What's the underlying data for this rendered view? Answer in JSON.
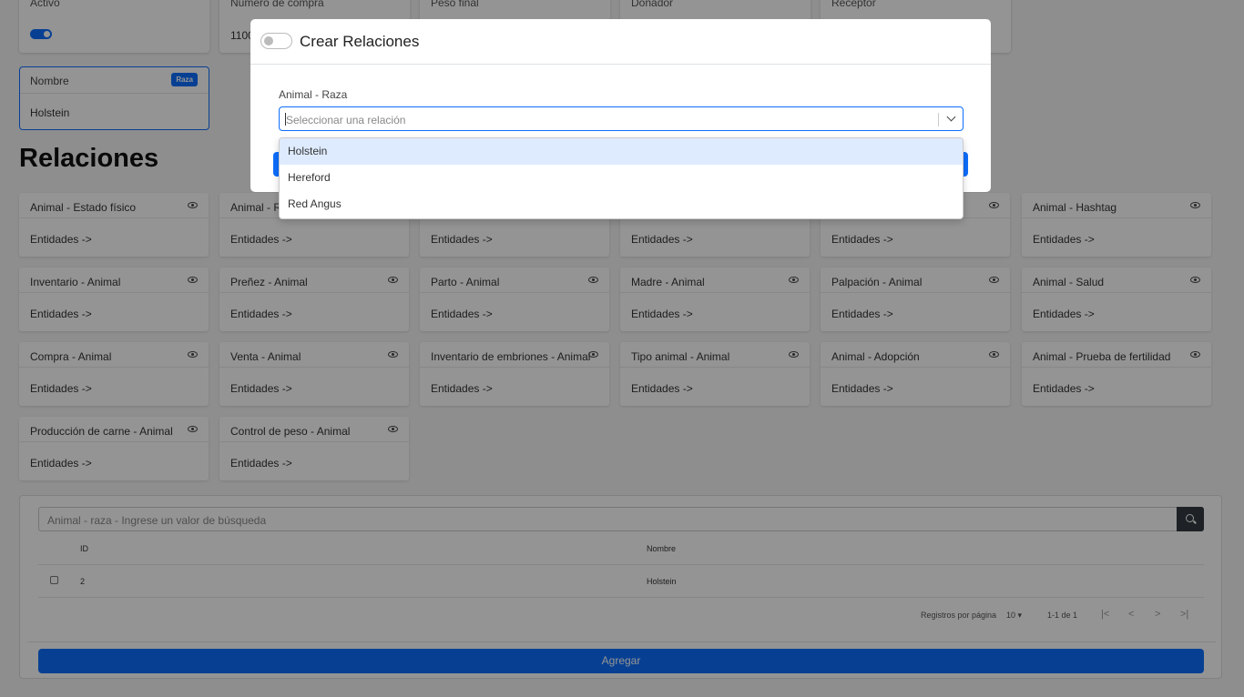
{
  "top_cards": [
    {
      "label": "Activo",
      "value": ""
    },
    {
      "label": "Número de compra",
      "value": "1100"
    },
    {
      "label": "Peso final",
      "value": ""
    },
    {
      "label": "Donador",
      "value": ""
    },
    {
      "label": "Receptor",
      "value": ""
    }
  ],
  "name_card": {
    "label": "Nombre",
    "badge": "Raza",
    "value": "Holstein"
  },
  "section_title": "Relaciones",
  "relations": [
    {
      "title": "Animal - Estado físico",
      "body": "Entidades ->"
    },
    {
      "title": "Animal - R",
      "body": "Entidades ->"
    },
    {
      "title": "",
      "body": "Entidades ->"
    },
    {
      "title": "",
      "body": "Entidades ->"
    },
    {
      "title": "",
      "body": "Entidades ->"
    },
    {
      "title": "Animal - Hashtag",
      "body": "Entidades ->"
    },
    {
      "title": "Inventario - Animal",
      "body": "Entidades ->"
    },
    {
      "title": "Preñez - Animal",
      "body": "Entidades ->"
    },
    {
      "title": "Parto - Animal",
      "body": "Entidades ->"
    },
    {
      "title": "Madre - Animal",
      "body": "Entidades ->"
    },
    {
      "title": "Palpación - Animal",
      "body": "Entidades ->"
    },
    {
      "title": "Animal - Salud",
      "body": "Entidades ->"
    },
    {
      "title": "Compra - Animal",
      "body": "Entidades ->"
    },
    {
      "title": "Venta - Animal",
      "body": "Entidades ->"
    },
    {
      "title": "Inventario de embriones - Animal",
      "body": "Entidades ->"
    },
    {
      "title": "Tipo animal - Animal",
      "body": "Entidades ->"
    },
    {
      "title": "Animal - Adopción",
      "body": "Entidades ->"
    },
    {
      "title": "Animal - Prueba de fertilidad",
      "body": "Entidades ->"
    },
    {
      "title": "Producción de carne - Animal",
      "body": "Entidades ->"
    },
    {
      "title": "Control de peso - Animal",
      "body": "Entidades ->"
    }
  ],
  "table": {
    "search_placeholder": "Animal - raza - Ingrese un valor de búsqueda",
    "columns": [
      "ID",
      "Nombre"
    ],
    "rows": [
      {
        "id": "2",
        "name": "Holstein"
      }
    ],
    "per_page_label": "Registros por página",
    "per_page_value": "10",
    "range": "1-1 de 1",
    "add_label": "Agregar"
  },
  "modal": {
    "title": "Crear Relaciones",
    "field_label": "Animal - Raza",
    "select_placeholder": "Seleccionar una relación",
    "options": [
      "Holstein",
      "Hereford",
      "Red Angus"
    ],
    "highlighted_option": "Holstein"
  },
  "colors": {
    "accent": "#0d6efd",
    "overlay": "rgba(0,0,0,0.42)"
  }
}
